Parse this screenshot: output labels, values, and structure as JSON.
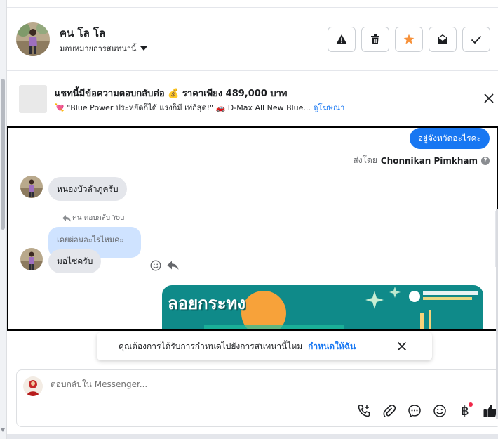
{
  "header": {
    "contact_name": "คน โล โล",
    "assign_label": "มอบหมายการสนทนานี้",
    "actions": [
      {
        "name": "warning-button",
        "icon": "warning-icon"
      },
      {
        "name": "delete-button",
        "icon": "trash-icon"
      },
      {
        "name": "star-button",
        "icon": "star-icon",
        "color": "#f7923b"
      },
      {
        "name": "mark-unread-button",
        "icon": "envelope-open-icon"
      },
      {
        "name": "done-button",
        "icon": "check-icon"
      }
    ]
  },
  "ad": {
    "title": "แชทนี้มีข้อความตอบกลับต่อ 💰 ราคาเพียง 489,000 บาท",
    "subtitle": "💘 \"Blue Power ประหยัดก็ได้ แรงก็มี เท่กี่สุด!\" 🚗 D-Max All New Blue...",
    "link": "ดูโฆษณา"
  },
  "conversation": {
    "outgoing_message": "อยู่จังหวัดอะไรคะ",
    "sent_by_prefix": "ส่งโดย",
    "sent_by_name": "Chonnikan Pimkham",
    "incoming_1": "หนองบัวลำภูครับ",
    "replied_label": "คน ตอบกลับ You",
    "quoted_text": "เคยผ่อนอะไรไหมคะ",
    "incoming_2": "มอไซครับ",
    "banner_text": "ลอยกระทง"
  },
  "suggestion": {
    "text": "คุณต้องการได้รับการกำหนดไปยังการสนทนานี้ไหม",
    "link": "กำหนดให้ฉัน"
  },
  "composer": {
    "placeholder": "ตอบกลับใน Messenger...",
    "tools": [
      "call-add-icon",
      "attachment-icon",
      "chat-bubble-icon",
      "emoji-icon",
      "baht-payment-icon",
      "like-icon"
    ],
    "baht_symbol": "฿"
  },
  "colors": {
    "accent": "#1877f2",
    "incoming_bubble": "#e4e6eb",
    "quoted_bubble": "#cfe3ff",
    "star": "#f7923b"
  }
}
